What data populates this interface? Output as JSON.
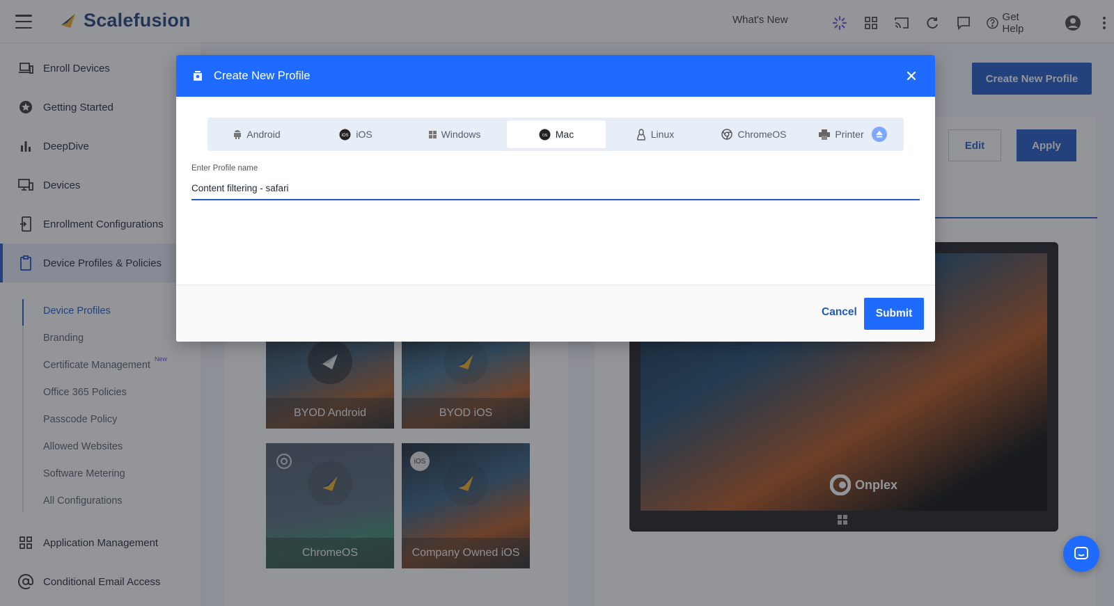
{
  "topbar": {
    "brand": "Scalefusion",
    "whats_new": "What's New",
    "get_help": "Get Help",
    "icons": [
      "spinner-icon",
      "grid-apps-icon",
      "cast-icon",
      "refresh-icon",
      "chat-icon",
      "help-icon",
      "account-icon",
      "kebab-menu-icon"
    ]
  },
  "sidebar": {
    "items": [
      {
        "label": "Enroll Devices",
        "icon": "laptop-phone-icon"
      },
      {
        "label": "Getting Started",
        "icon": "star-badge-icon"
      },
      {
        "label": "DeepDive",
        "icon": "bar-chart-icon"
      },
      {
        "label": "Devices",
        "icon": "devices-icon"
      },
      {
        "label": "Enrollment Configurations",
        "icon": "enrollment-icon"
      },
      {
        "label": "Device Profiles & Policies",
        "icon": "clipboard-icon"
      },
      {
        "label": "Application Management",
        "icon": "apps-grid-icon"
      },
      {
        "label": "Conditional Email Access",
        "icon": "at-sign-icon"
      }
    ],
    "sub_items": [
      {
        "label": "Device Profiles"
      },
      {
        "label": "Branding"
      },
      {
        "label": "Certificate Management",
        "tag": "New"
      },
      {
        "label": "Office 365 Policies"
      },
      {
        "label": "Passcode Policy"
      },
      {
        "label": "Allowed Websites"
      },
      {
        "label": "Software Metering"
      },
      {
        "label": "All Configurations"
      }
    ]
  },
  "main": {
    "create_button": "Create New Profile",
    "edit_button": "Edit",
    "apply_button": "Apply",
    "tiles": [
      {
        "label": "BYOD Android"
      },
      {
        "label": "BYOD iOS"
      },
      {
        "label": "ChromeOS"
      },
      {
        "label": "Company Owned iOS",
        "badge": "iOS"
      }
    ],
    "preview_brand": "Onplex"
  },
  "modal": {
    "title": "Create New Profile",
    "tabs": [
      {
        "label": "Android",
        "icon": "android-icon"
      },
      {
        "label": "iOS",
        "icon": "ios-icon"
      },
      {
        "label": "Windows",
        "icon": "windows-icon"
      },
      {
        "label": "Mac",
        "icon": "macos-icon",
        "active": true
      },
      {
        "label": "Linux",
        "icon": "linux-icon"
      },
      {
        "label": "ChromeOS",
        "icon": "chrome-icon"
      },
      {
        "label": "Printer",
        "icon": "printer-icon"
      }
    ],
    "field_label": "Enter Profile name",
    "field_value": "Content filtering - safari",
    "cancel": "Cancel",
    "submit": "Submit"
  },
  "colors": {
    "accent": "#1f6bff",
    "brand_dark": "#1d3f7a",
    "primary_button": "#1f57c7"
  }
}
